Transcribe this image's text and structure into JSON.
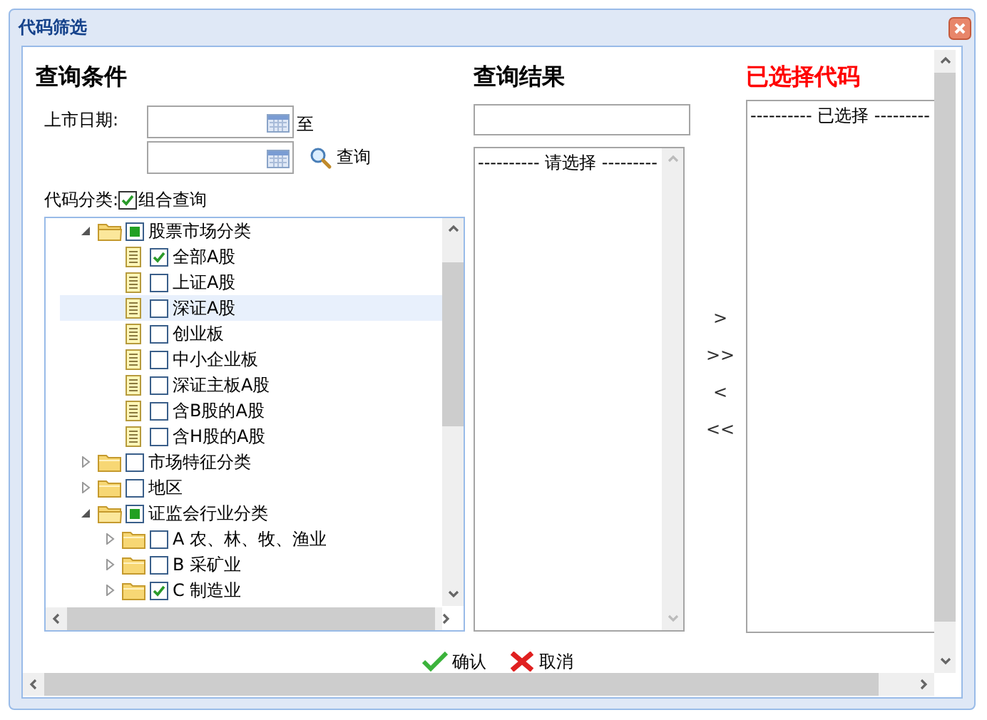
{
  "window": {
    "title": "代码筛选"
  },
  "conditions": {
    "heading": "查询条件",
    "date_label": "上市日期:",
    "date_separator": "至",
    "search_link": "查询",
    "category_label": "代码分类:",
    "combo": {
      "label": "组合查询",
      "checked": true
    },
    "tree": [
      {
        "label": "股票市场分类",
        "kind": "folder",
        "expanded": true,
        "checked": false,
        "partial": true,
        "selected": false,
        "children": [
          {
            "label": "全部A股",
            "kind": "file",
            "checked": true,
            "partial": false,
            "selected": false
          },
          {
            "label": "上证A股",
            "kind": "file",
            "checked": false,
            "partial": false,
            "selected": false
          },
          {
            "label": "深证A股",
            "kind": "file",
            "checked": false,
            "partial": false,
            "selected": true
          },
          {
            "label": "创业板",
            "kind": "file",
            "checked": false,
            "partial": false,
            "selected": false
          },
          {
            "label": "中小企业板",
            "kind": "file",
            "checked": false,
            "partial": false,
            "selected": false
          },
          {
            "label": "深证主板A股",
            "kind": "file",
            "checked": false,
            "partial": false,
            "selected": false
          },
          {
            "label": "含B股的A股",
            "kind": "file",
            "checked": false,
            "partial": false,
            "selected": false
          },
          {
            "label": "含H股的A股",
            "kind": "file",
            "checked": false,
            "partial": false,
            "selected": false
          }
        ]
      },
      {
        "label": "市场特征分类",
        "kind": "folder",
        "expanded": false,
        "checked": false,
        "partial": false,
        "selected": false
      },
      {
        "label": "地区",
        "kind": "folder",
        "expanded": false,
        "checked": false,
        "partial": false,
        "selected": false
      },
      {
        "label": "证监会行业分类",
        "kind": "folder",
        "expanded": true,
        "checked": false,
        "partial": true,
        "selected": false,
        "children": [
          {
            "label": "A 农、林、牧、渔业",
            "kind": "folder",
            "expanded": false,
            "checked": false,
            "partial": false,
            "selected": false
          },
          {
            "label": "B 采矿业",
            "kind": "folder",
            "expanded": false,
            "checked": false,
            "partial": false,
            "selected": false
          },
          {
            "label": "C 制造业",
            "kind": "folder",
            "expanded": false,
            "checked": true,
            "partial": false,
            "selected": false
          }
        ]
      }
    ]
  },
  "results": {
    "heading": "查询结果",
    "list_header": "---------- 请选择 ---------"
  },
  "transfer_buttons": [
    ">",
    ">>",
    "<",
    "<<"
  ],
  "selected_codes": {
    "heading": "已选择代码",
    "list_header": "---------- 已选择 ---------"
  },
  "buttons": [
    {
      "label": "确认",
      "kind": "confirm"
    },
    {
      "label": "取消",
      "kind": "cancel"
    }
  ]
}
